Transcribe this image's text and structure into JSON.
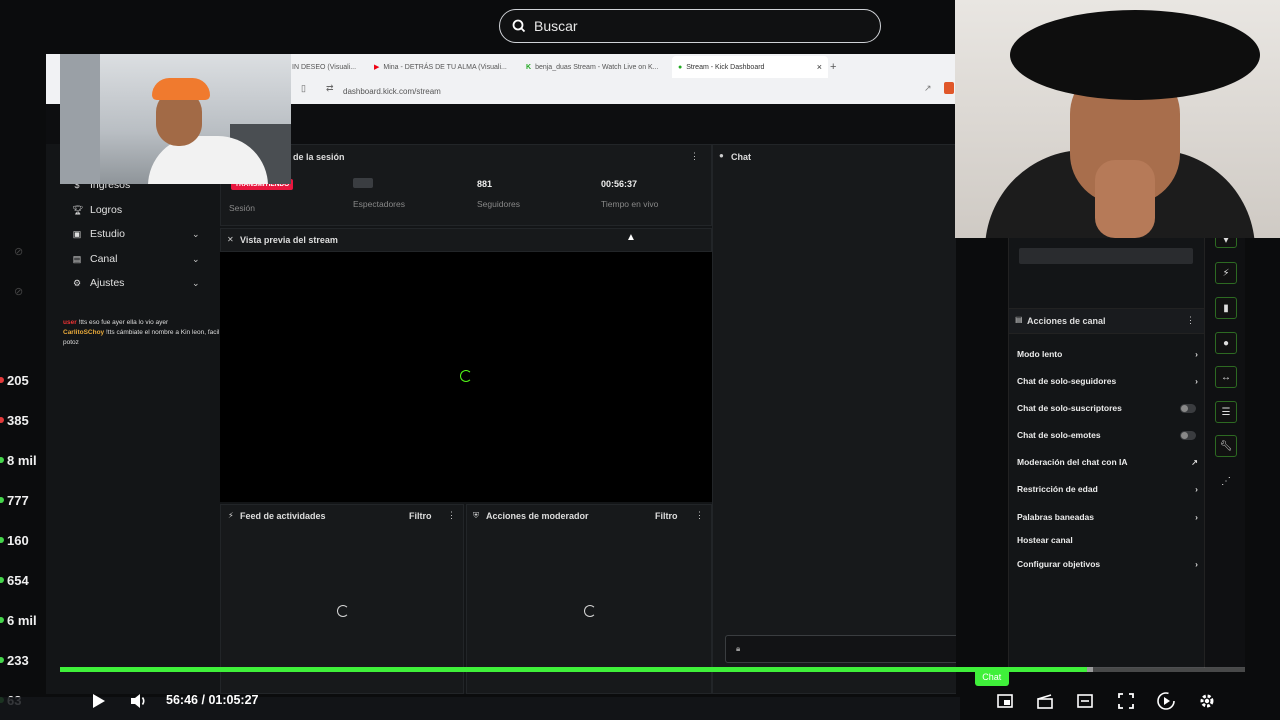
{
  "search": {
    "placeholder": "Buscar"
  },
  "viewer_counts": [
    "205",
    "385",
    "8 mil",
    "777",
    "160",
    "654",
    "6 mil",
    "233",
    "63"
  ],
  "browser": {
    "tabs": [
      "IN DESEO (Visuali...",
      "Mina - DETRÁS DE TU ALMA (Visuali...",
      "benja_duas Stream - Watch Live on K...",
      "Stream - Kick Dashboard"
    ],
    "url": "dashboard.kick.com/stream"
  },
  "sidebar": {
    "items": [
      {
        "label": "Ingresos"
      },
      {
        "label": "Logros"
      },
      {
        "label": "Estudio"
      },
      {
        "label": "Canal"
      },
      {
        "label": "Ajustes"
      }
    ],
    "chat_lines": [
      {
        "user": "user",
        "text": "!tts eso fue ayer ella lo vio ayer"
      },
      {
        "user": "CarlitoSChoy",
        "text": "!tts cámbiate el nombre a Kin leon, facil ahi si te van a querer 7 potoz"
      }
    ]
  },
  "session": {
    "title": "de la sesión",
    "live_badge": "TRANSMITIENDO",
    "session_label": "Sesión",
    "viewers_label": "Espectadores",
    "followers_value": "881",
    "followers_label": "Seguidores",
    "uptime_value": "00:56:37",
    "uptime_label": "Tiempo en vivo"
  },
  "preview": {
    "title": "Vista previa del stream"
  },
  "activity": {
    "title": "Feed de actividades",
    "filter": "Filtro"
  },
  "moderator": {
    "title": "Acciones de moderador",
    "filter": "Filtro"
  },
  "chat": {
    "title": "Chat"
  },
  "channel_actions": {
    "title": "Acciones de canal",
    "items": [
      {
        "label": "Modo lento"
      },
      {
        "label": "Chat de solo-seguidores"
      },
      {
        "label": "Chat de solo-suscriptores"
      },
      {
        "label": "Chat de solo-emotes"
      },
      {
        "label": "Moderación del chat con IA"
      },
      {
        "label": "Restricción de edad"
      },
      {
        "label": "Palabras baneadas"
      },
      {
        "label": "Hostear canal"
      },
      {
        "label": "Configurar objetivos"
      }
    ]
  },
  "player": {
    "current_time": "56:46",
    "separator": "/",
    "duration": "01:05:27",
    "progress_fraction": 0.867,
    "buffer_fraction": 0.872,
    "chat_button": "Chat"
  },
  "colors": {
    "kick_green": "#53fc18",
    "progress_green": "#3ff03a",
    "live_red": "#e8173f"
  }
}
